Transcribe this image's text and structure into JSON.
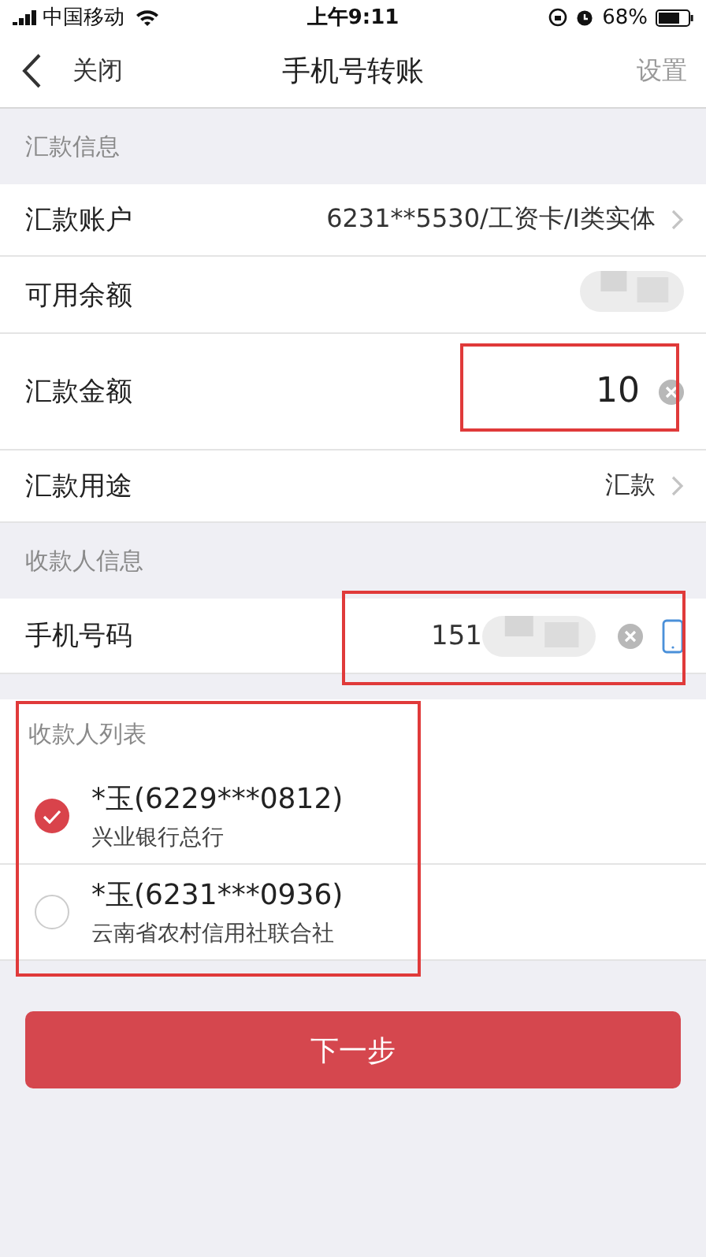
{
  "status_bar": {
    "carrier": "中国移动",
    "time": "上午9:11",
    "battery": "68%"
  },
  "nav": {
    "back": "关闭",
    "title": "手机号转账",
    "action": "设置"
  },
  "payer_section": {
    "title": "汇款信息"
  },
  "payer_rows": [
    {
      "kind": "link",
      "label": "汇款账户",
      "value": "6231**5530/工资卡/I类实体"
    },
    {
      "kind": "blurred",
      "label": "可用余额"
    },
    {
      "kind": "amount",
      "label": "汇款金额",
      "value": "10",
      "highlighted": true
    },
    {
      "kind": "link",
      "label": "汇款用途",
      "value": "汇款"
    }
  ],
  "payee_section": {
    "title": "收款人信息"
  },
  "phone": {
    "label": "手机号码",
    "value": "151",
    "highlighted": true
  },
  "payee_list": {
    "title": "收款人列表",
    "highlighted": true,
    "items": [
      {
        "name": "*玉(6229***0812)",
        "bank": "兴业银行总行",
        "selected": true
      },
      {
        "name": "*玉(6231***0936)",
        "bank": "云南省农村信用社联合社",
        "selected": false
      }
    ]
  },
  "next_button": "下一步"
}
